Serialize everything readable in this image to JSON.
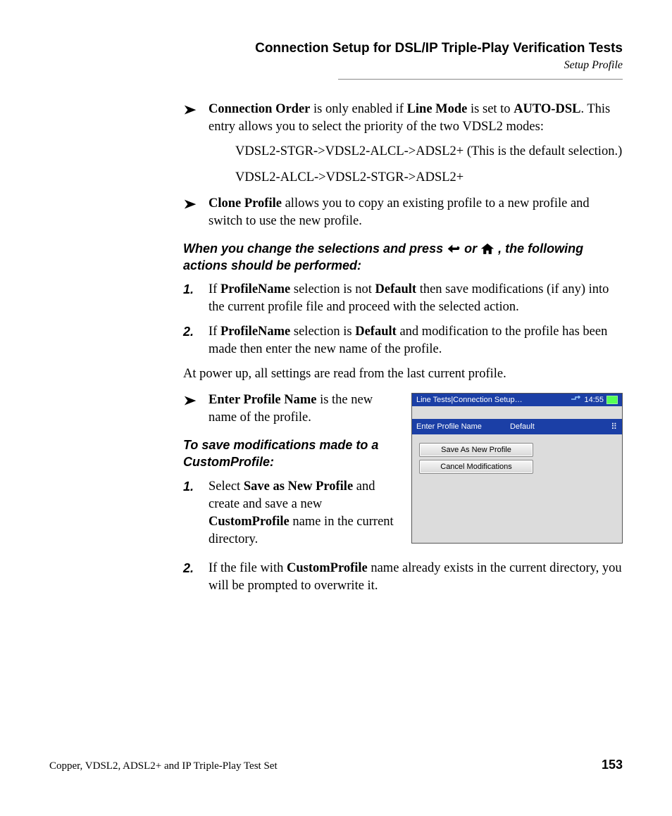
{
  "header": {
    "chapter": "Connection Setup for DSL/IP Triple-Play Verification Tests",
    "section": "Setup Profile"
  },
  "b1": {
    "term": "Connection Order",
    "mid1": " is only enabled if ",
    "term2": "Line Mode",
    "mid2": " is set to ",
    "term3": "AUTO-DSL",
    "tail": ". This entry allows you to select the priority of the two VDSL2 modes:"
  },
  "opt1": "VDSL2-STGR->VDSL2-ALCL->ADSL2+ (This is the default selection.)",
  "opt2": "VDSL2-ALCL->VDSL2-STGR->ADSL2+",
  "b2": {
    "term": "Clone Profile",
    "tail": " allows you to copy an existing profile to a new profile and switch to use the new profile."
  },
  "actionHeading": {
    "pre": "When you change the selections and press ",
    "or": " or ",
    "post": ", the following actions should be performed:"
  },
  "num1": "1.",
  "num2": "2.",
  "step1": {
    "p1": "If ",
    "b1": "ProfileName",
    "p2": " selection is not ",
    "b2": "Default",
    "p3": " then save modifications (if any) into the current profile file and proceed with the selected action."
  },
  "step2": {
    "p1": "If ",
    "b1": "ProfileName",
    "p2": " selection is ",
    "b2": "Default",
    "p3": " and modification to the profile has been made then enter the new name of the profile."
  },
  "powerUp": "At power up, all settings are read from the last current profile.",
  "b3": {
    "term": "Enter Profile Name",
    "tail": " is the new name of the profile."
  },
  "saveHeading": "To save modifications made to a CustomProfile:",
  "save1": {
    "p1": "Select ",
    "b1": "Save as New Profile",
    "p2": " and create and save a new ",
    "b2": "CustomProfile",
    "p3": " name in the current directory."
  },
  "save2": {
    "p1": "If the file with ",
    "b1": "CustomProfile",
    "p2": " name already exists in the current directory, you will be prompted to overwrite it."
  },
  "fig": {
    "breadcrumb": "Line Tests|Connection Setup…",
    "time": "14:55",
    "rowLabel": "Enter Profile Name",
    "rowValue": "Default",
    "btn1": "Save As New Profile",
    "btn2": "Cancel Modifications"
  },
  "footer": {
    "product": "Copper, VDSL2, ADSL2+ and IP Triple-Play Test Set",
    "page": "153"
  }
}
